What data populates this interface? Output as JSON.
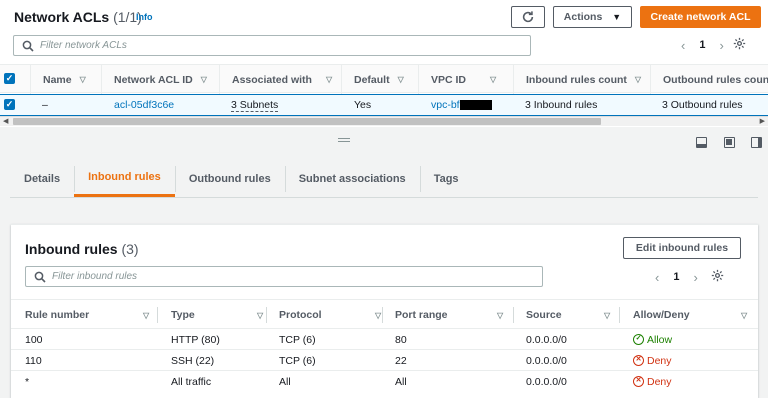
{
  "header": {
    "title": "Network ACLs",
    "count": "(1/1)",
    "info_label": "Info",
    "refresh_icon": "refresh-icon",
    "actions_label": "Actions",
    "create_label": "Create network ACL"
  },
  "top_search": {
    "placeholder": "Filter network ACLs"
  },
  "top_pager": {
    "page": "1"
  },
  "top_table": {
    "columns": [
      "Name",
      "Network ACL ID",
      "Associated with",
      "Default",
      "VPC ID",
      "Inbound rules count",
      "Outbound rules count"
    ],
    "row": {
      "name": "–",
      "acl_id": "acl-05df3c6e",
      "associated": "3 Subnets",
      "default": "Yes",
      "vpc_id": "vpc-bf",
      "inbound_count": "3 Inbound rules",
      "outbound_count": "3 Outbound rules"
    }
  },
  "tabs": [
    "Details",
    "Inbound rules",
    "Outbound rules",
    "Subnet associations",
    "Tags"
  ],
  "active_tab": "Inbound rules",
  "inbound": {
    "title": "Inbound rules",
    "count": "(3)",
    "edit_label": "Edit inbound rules",
    "search_placeholder": "Filter inbound rules",
    "page": "1",
    "columns": [
      "Rule number",
      "Type",
      "Protocol",
      "Port range",
      "Source",
      "Allow/Deny"
    ],
    "rows": [
      {
        "rule": "100",
        "type": "HTTP (80)",
        "protocol": "TCP (6)",
        "port": "80",
        "source": "0.0.0.0/0",
        "action": "Allow"
      },
      {
        "rule": "110",
        "type": "SSH (22)",
        "protocol": "TCP (6)",
        "port": "22",
        "source": "0.0.0.0/0",
        "action": "Deny"
      },
      {
        "rule": "*",
        "type": "All traffic",
        "protocol": "All",
        "port": "All",
        "source": "0.0.0.0/0",
        "action": "Deny"
      }
    ]
  },
  "colors": {
    "accent": "#ec7211",
    "link": "#0073bb",
    "allow": "#1d8102",
    "deny": "#d13212"
  }
}
